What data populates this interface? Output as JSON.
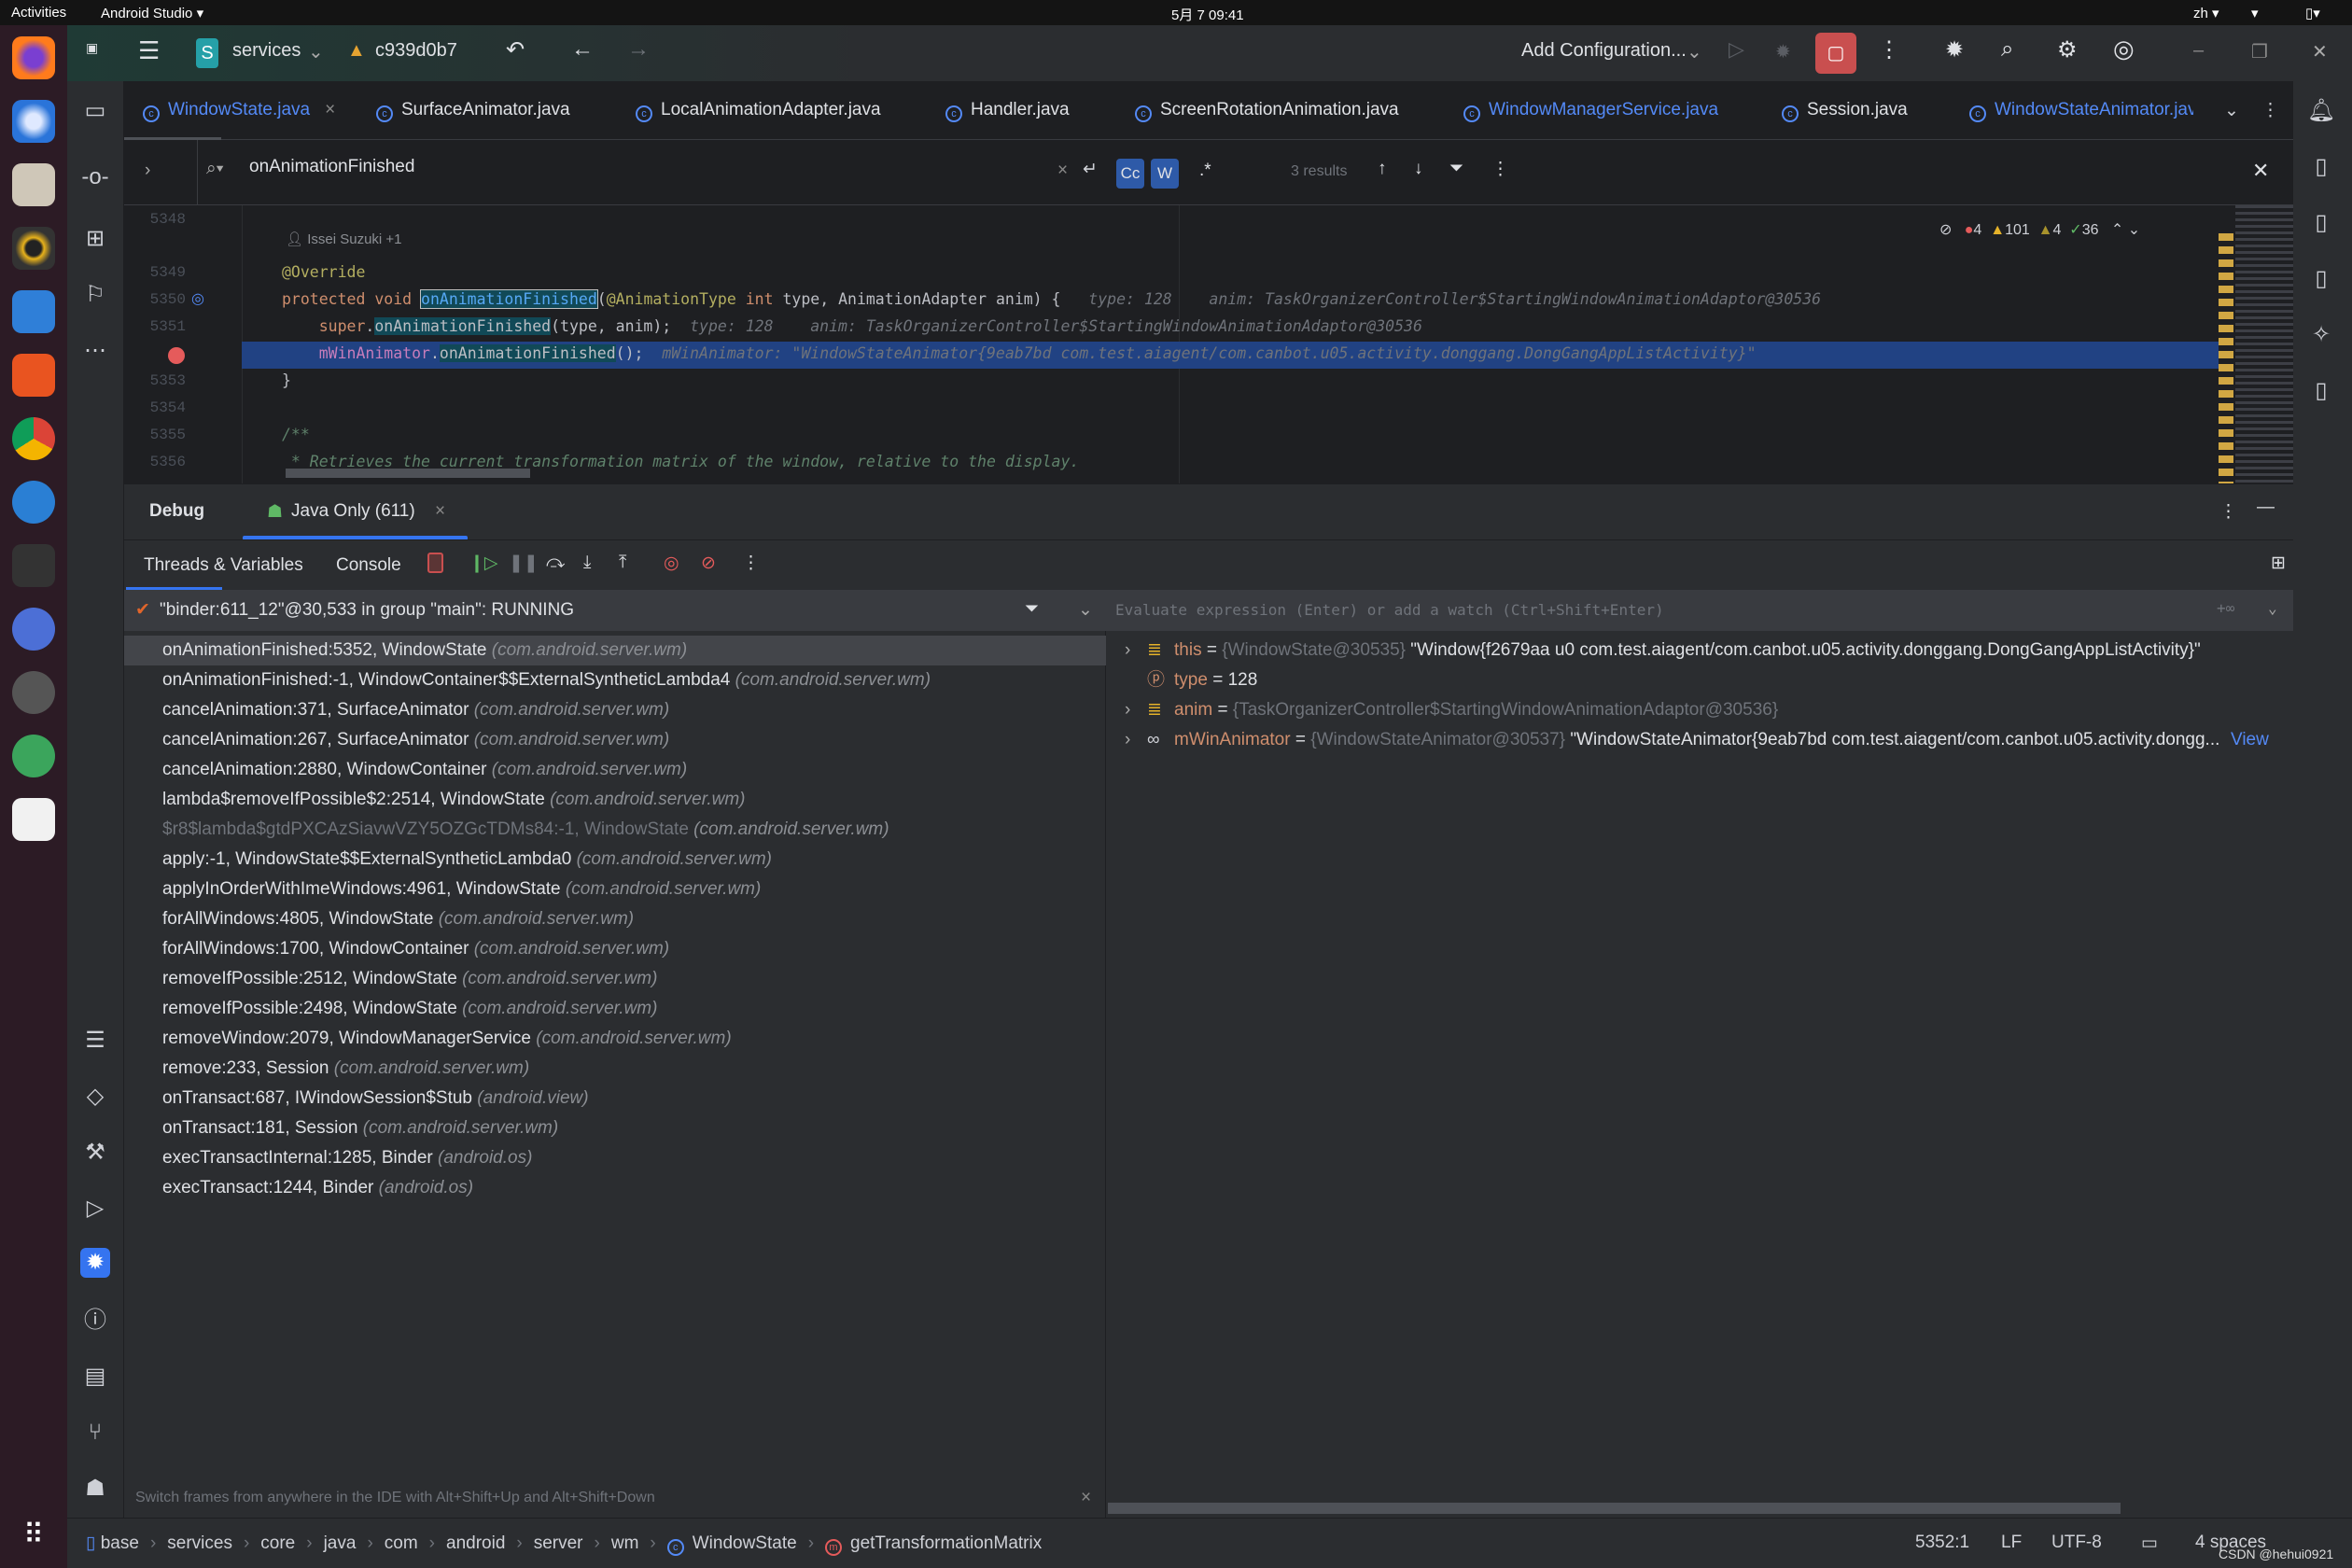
{
  "system_bar": {
    "activities": "Activities",
    "app_menu": "Android Studio ▾",
    "clock": "5月 7  09:41",
    "lang": "zh ▾"
  },
  "titlebar": {
    "project_badge": "S",
    "project": "services",
    "branch": "c939d0b7",
    "run_config": "Add Configuration...",
    "accent_stop": "#c94f4f"
  },
  "tabs": [
    {
      "label": "WindowState.java",
      "active": true
    },
    {
      "label": "SurfaceAnimator.java"
    },
    {
      "label": "LocalAnimationAdapter.java"
    },
    {
      "label": "Handler.java"
    },
    {
      "label": "ScreenRotationAnimation.java"
    },
    {
      "label": "WindowManagerService.java"
    },
    {
      "label": "Session.java"
    },
    {
      "label": "WindowStateAnimator.jav"
    }
  ],
  "find": {
    "query": "onAnimationFinished",
    "case_btn": "Cc",
    "word_btn": "W",
    "regex_btn": ".*",
    "results": "3 results"
  },
  "inspections": {
    "errors": "4",
    "warnings": "101",
    "weak_warnings": "4",
    "ok": "36"
  },
  "editor": {
    "author_hint": "Issei Suzuki +1",
    "lines": [
      {
        "num": "5348",
        "segs": []
      },
      {
        "num": "5349",
        "segs": [
          {
            "t": "@Override",
            "c": "ann"
          }
        ]
      },
      {
        "num": "5350",
        "segs": [
          {
            "t": "protected void ",
            "c": "kw"
          },
          {
            "t": "onAnimationFinished",
            "c": "fn mbox"
          },
          {
            "t": "(",
            "c": ""
          },
          {
            "t": "@AnimationType ",
            "c": "ann"
          },
          {
            "t": "int ",
            "c": "kw"
          },
          {
            "t": "type, AnimationAdapter anim) {   ",
            "c": ""
          },
          {
            "t": "type: 128    anim: TaskOrganizerController$StartingWindowAnimationAdaptor@30536",
            "c": "hint"
          }
        ]
      },
      {
        "num": "5351",
        "segs": [
          {
            "t": "    super",
            "c": "kw"
          },
          {
            "t": ".",
            "c": ""
          },
          {
            "t": "onAnimationFinished",
            "c": "mhl"
          },
          {
            "t": "(type, anim);  ",
            "c": ""
          },
          {
            "t": "type: 128    anim: TaskOrganizerController$StartingWindowAnimationAdaptor@30536",
            "c": "hint"
          }
        ]
      },
      {
        "num": "",
        "breakpoint": true,
        "segs": [
          {
            "t": "    mWinAnimator",
            "c": "fld"
          },
          {
            "t": ".",
            "c": ""
          },
          {
            "t": "onAnimationFinished",
            "c": "mhl"
          },
          {
            "t": "();  ",
            "c": ""
          },
          {
            "t": "mWinAnimator: \"WindowStateAnimator{9eab7bd com.test.aiagent/com.canbot.u05.activity.donggang.DongGangAppListActivity}\"",
            "c": "hint"
          }
        ]
      },
      {
        "num": "5353",
        "segs": [
          {
            "t": "}",
            "c": ""
          }
        ]
      },
      {
        "num": "5354",
        "segs": []
      },
      {
        "num": "5355",
        "segs": [
          {
            "t": "/**",
            "c": "cmt"
          }
        ]
      },
      {
        "num": "5356",
        "segs": [
          {
            "t": " * Retrieves the current transformation matrix of the window, relative to the display.",
            "c": "cmt"
          }
        ]
      }
    ]
  },
  "debug": {
    "title": "Debug",
    "session_tab": "Java Only (611)",
    "tab_threads": "Threads & Variables",
    "tab_console": "Console",
    "thread": "\"binder:611_12\"@30,533 in group \"main\": RUNNING",
    "frames": [
      {
        "m": "onAnimationFinished:5352, WindowState",
        "p": "(com.android.server.wm)",
        "selected": true
      },
      {
        "m": "onAnimationFinished:-1, WindowContainer$$ExternalSyntheticLambda4",
        "p": "(com.android.server.wm)"
      },
      {
        "m": "cancelAnimation:371, SurfaceAnimator",
        "p": "(com.android.server.wm)"
      },
      {
        "m": "cancelAnimation:267, SurfaceAnimator",
        "p": "(com.android.server.wm)"
      },
      {
        "m": "cancelAnimation:2880, WindowContainer",
        "p": "(com.android.server.wm)"
      },
      {
        "m": "lambda$removeIfPossible$2:2514, WindowState",
        "p": "(com.android.server.wm)"
      },
      {
        "m": "$r8$lambda$gtdPXCAzSiavwVZY5OZGcTDMs84:-1, WindowState",
        "p": "(com.android.server.wm)",
        "dim": true
      },
      {
        "m": "apply:-1, WindowState$$ExternalSyntheticLambda0",
        "p": "(com.android.server.wm)"
      },
      {
        "m": "applyInOrderWithImeWindows:4961, WindowState",
        "p": "(com.android.server.wm)"
      },
      {
        "m": "forAllWindows:4805, WindowState",
        "p": "(com.android.server.wm)"
      },
      {
        "m": "forAllWindows:1700, WindowContainer",
        "p": "(com.android.server.wm)"
      },
      {
        "m": "removeIfPossible:2512, WindowState",
        "p": "(com.android.server.wm)"
      },
      {
        "m": "removeIfPossible:2498, WindowState",
        "p": "(com.android.server.wm)"
      },
      {
        "m": "removeWindow:2079, WindowManagerService",
        "p": "(com.android.server.wm)"
      },
      {
        "m": "remove:233, Session",
        "p": "(com.android.server.wm)"
      },
      {
        "m": "onTransact:687, IWindowSession$Stub",
        "p": "(android.view)"
      },
      {
        "m": "onTransact:181, Session",
        "p": "(com.android.server.wm)"
      },
      {
        "m": "execTransactInternal:1285, Binder",
        "p": "(android.os)"
      },
      {
        "m": "execTransact:1244, Binder",
        "p": "(android.os)"
      }
    ],
    "hint": "Switch frames from anywhere in the IDE with Alt+Shift+Up and Alt+Shift+Down",
    "eval_placeholder": "Evaluate expression (Enter) or add a watch (Ctrl+Shift+Enter)",
    "variables": [
      {
        "icon": "field",
        "expand": true,
        "name": "this",
        "type": "{WindowState@30535}",
        "value": "\"Window{f2679aa u0 com.test.aiagent/com.canbot.u05.activity.donggang.DongGangAppListActivity}\""
      },
      {
        "icon": "param",
        "expand": false,
        "name": "type",
        "type": "",
        "value": "128"
      },
      {
        "icon": "field",
        "expand": true,
        "name": "anim",
        "type": "{TaskOrganizerController$StartingWindowAnimationAdaptor@30536}",
        "value": ""
      },
      {
        "icon": "watch",
        "expand": true,
        "name": "mWinAnimator",
        "type": "{WindowStateAnimator@30537}",
        "value": "\"WindowStateAnimator{9eab7bd com.test.aiagent/com.canbot.u05.activity.dongg...",
        "link": "View"
      }
    ]
  },
  "statusbar": {
    "breadcrumb": [
      "base",
      "services",
      "core",
      "java",
      "com",
      "android",
      "server",
      "wm"
    ],
    "class": "WindowState",
    "method": "getTransformationMatrix",
    "position": "5352:1",
    "line_sep": "LF",
    "encoding": "UTF-8",
    "indent": "4 spaces",
    "watermark": "CSDN @hehui0921"
  }
}
